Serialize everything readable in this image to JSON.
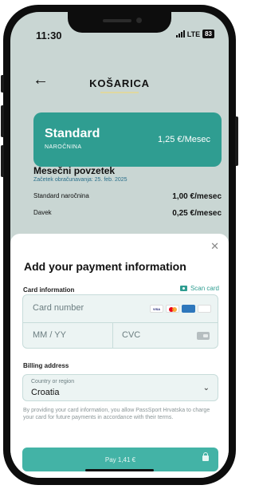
{
  "status_bar": {
    "time": "11:30",
    "network": "LTE",
    "battery": "83"
  },
  "header": {
    "title": "KOŠARICA"
  },
  "plan": {
    "name": "Standard",
    "subtitle": "NAROČNINA",
    "price": "1,25 €/Mesec"
  },
  "summary": {
    "title": "Mesečni povzetek",
    "billing_start": "Začetek obračunavanja: 25. feb. 2025",
    "rows": [
      {
        "label": "Standard naročnina",
        "value": "1,00 €/mesec"
      },
      {
        "label": "Davek",
        "value": "0,25 €/mesec"
      }
    ]
  },
  "payment_sheet": {
    "title": "Add your payment information",
    "card_info_label": "Card information",
    "scan_card": "Scan card",
    "card_number_placeholder": "Card number",
    "expiry_placeholder": "MM / YY",
    "cvc_placeholder": "CVC",
    "brands": [
      "VISA",
      "MC",
      "AMEX",
      "DISCOVER"
    ],
    "billing_address_label": "Billing address",
    "country_label": "Country or region",
    "country_value": "Croatia",
    "disclaimer": "By providing your card information, you allow PassSport Hrvatska to charge your card for future payments in accordance with their terms.",
    "pay_button": "Pay 1,41 €"
  },
  "colors": {
    "accent": "#2f9d91",
    "pay_button": "#43b3a6",
    "backdrop": "#c9d6d3"
  }
}
